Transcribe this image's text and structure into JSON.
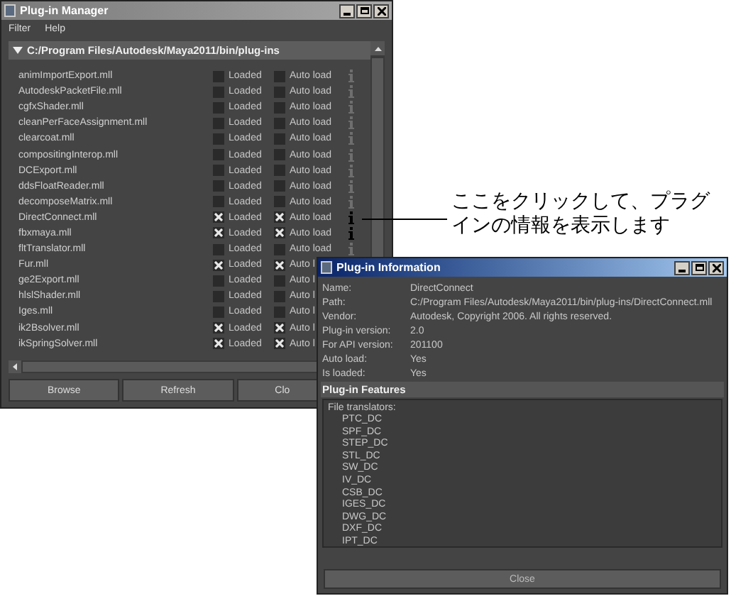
{
  "manager": {
    "title": "Plug-in Manager",
    "menu": [
      "Filter",
      "Help"
    ],
    "folder": {
      "path": "C:/Program Files/Autodesk/Maya2011/bin/plug-ins",
      "expanded": true
    },
    "plugins": [
      {
        "name": "animImportExport.mll",
        "loaded": false,
        "loaded_label": "Loaded",
        "auto_load": false,
        "auto_load_label": "Auto load",
        "info_highlighted": false
      },
      {
        "name": "AutodeskPacketFile.mll",
        "loaded": false,
        "loaded_label": "Loaded",
        "auto_load": false,
        "auto_load_label": "Auto load",
        "info_highlighted": false
      },
      {
        "name": "cgfxShader.mll",
        "loaded": false,
        "loaded_label": "Loaded",
        "auto_load": false,
        "auto_load_label": "Auto load",
        "info_highlighted": false
      },
      {
        "name": "cleanPerFaceAssignment.mll",
        "loaded": false,
        "loaded_label": "Loaded",
        "auto_load": false,
        "auto_load_label": "Auto load",
        "info_highlighted": false
      },
      {
        "name": "clearcoat.mll",
        "loaded": false,
        "loaded_label": "Loaded",
        "auto_load": false,
        "auto_load_label": "Auto load",
        "info_highlighted": false
      },
      {
        "name": "compositingInterop.mll",
        "loaded": false,
        "loaded_label": "Loaded",
        "auto_load": false,
        "auto_load_label": "Auto load",
        "info_highlighted": false
      },
      {
        "name": "DCExport.mll",
        "loaded": false,
        "loaded_label": "Loaded",
        "auto_load": false,
        "auto_load_label": "Auto load",
        "info_highlighted": false
      },
      {
        "name": "ddsFloatReader.mll",
        "loaded": false,
        "loaded_label": "Loaded",
        "auto_load": false,
        "auto_load_label": "Auto load",
        "info_highlighted": false
      },
      {
        "name": "decomposeMatrix.mll",
        "loaded": false,
        "loaded_label": "Loaded",
        "auto_load": false,
        "auto_load_label": "Auto load",
        "info_highlighted": false
      },
      {
        "name": "DirectConnect.mll",
        "loaded": true,
        "loaded_label": "Loaded",
        "auto_load": true,
        "auto_load_label": "Auto load",
        "info_highlighted": true
      },
      {
        "name": "fbxmaya.mll",
        "loaded": true,
        "loaded_label": "Loaded",
        "auto_load": true,
        "auto_load_label": "Auto load",
        "info_highlighted": true
      },
      {
        "name": "fltTranslator.mll",
        "loaded": false,
        "loaded_label": "Loaded",
        "auto_load": false,
        "auto_load_label": "Auto load",
        "info_highlighted": false
      },
      {
        "name": "Fur.mll",
        "loaded": true,
        "loaded_label": "Loaded",
        "auto_load": true,
        "auto_load_label": "Auto l"
      },
      {
        "name": "ge2Export.mll",
        "loaded": false,
        "loaded_label": "Loaded",
        "auto_load": false,
        "auto_load_label": "Auto l"
      },
      {
        "name": "hlslShader.mll",
        "loaded": false,
        "loaded_label": "Loaded",
        "auto_load": false,
        "auto_load_label": "Auto l"
      },
      {
        "name": "Iges.mll",
        "loaded": false,
        "loaded_label": "Loaded",
        "auto_load": false,
        "auto_load_label": "Auto l"
      },
      {
        "name": "ik2Bsolver.mll",
        "loaded": true,
        "loaded_label": "Loaded",
        "auto_load": true,
        "auto_load_label": "Auto l"
      },
      {
        "name": "ikSpringSolver.mll",
        "loaded": true,
        "loaded_label": "Loaded",
        "auto_load": true,
        "auto_load_label": "Auto l"
      }
    ],
    "buttons": [
      "Browse",
      "Refresh",
      "Clo"
    ]
  },
  "annotation": {
    "text": "ここをクリックして、プラグインの情報を表示します"
  },
  "info_window": {
    "title": "Plug-in Information",
    "fields": [
      {
        "label": "Name:",
        "value": "DirectConnect"
      },
      {
        "label": "Path:",
        "value": "C:/Program Files/Autodesk/Maya2011/bin/plug-ins/DirectConnect.mll"
      },
      {
        "label": "Vendor:",
        "value": "Autodesk, Copyright 2006. All rights reserved."
      },
      {
        "label": "Plug-in version:",
        "value": "2.0"
      },
      {
        "label": "For API version:",
        "value": "201100"
      },
      {
        "label": "Auto load:",
        "value": "Yes"
      },
      {
        "label": "Is loaded:",
        "value": "Yes"
      }
    ],
    "features_title": "Plug-in Features",
    "features": {
      "heading": "File translators:",
      "items": [
        "PTC_DC",
        "SPF_DC",
        "STEP_DC",
        "STL_DC",
        "SW_DC",
        "IV_DC",
        "CSB_DC",
        "IGES_DC",
        "DWG_DC",
        "DXF_DC",
        "IPT_DC"
      ]
    },
    "close_button": "Close"
  }
}
